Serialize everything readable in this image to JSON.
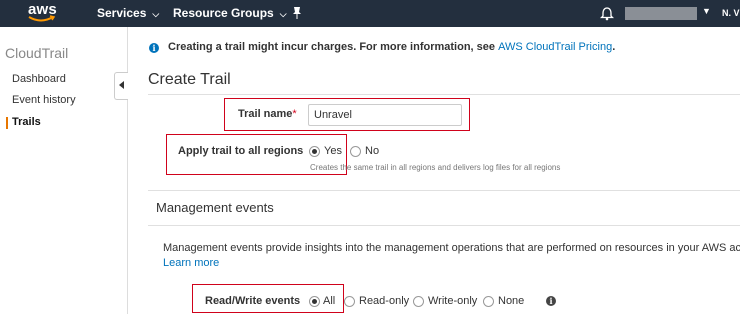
{
  "topnav": {
    "logo_text": "aws",
    "services_label": "Services",
    "resource_groups_label": "Resource Groups",
    "region_label": "N. V"
  },
  "sidebar": {
    "title": "CloudTrail",
    "items": [
      {
        "label": "Dashboard",
        "active": false
      },
      {
        "label": "Event history",
        "active": false
      },
      {
        "label": "Trails",
        "active": true
      }
    ]
  },
  "notice": {
    "text": "Creating a trail might incur charges. For more information, see ",
    "link_text": "AWS CloudTrail Pricing",
    "suffix": "."
  },
  "page_title": "Create Trail",
  "form": {
    "trail_name_label": "Trail name",
    "required_mark": "*",
    "trail_name_value": "Unravel",
    "apply_all_regions_label": "Apply trail to all regions",
    "apply_options": [
      {
        "label": "Yes",
        "checked": true
      },
      {
        "label": "No",
        "checked": false
      }
    ],
    "apply_hint": "Creates the same trail in all regions and delivers log files for all regions"
  },
  "management_events": {
    "title": "Management events",
    "description": "Management events provide insights into the management operations that are performed on resources in your AWS account.",
    "learn_more": "Learn more",
    "rw_label": "Read/Write events",
    "rw_options": [
      {
        "label": "All",
        "checked": true
      },
      {
        "label": "Read-only",
        "checked": false
      },
      {
        "label": "Write-only",
        "checked": false
      },
      {
        "label": "None",
        "checked": false
      }
    ]
  },
  "colors": {
    "nav_bg": "#232f3e",
    "accent_orange": "#e77600",
    "link_blue": "#0073bb",
    "highlight_red": "#d0021b"
  }
}
